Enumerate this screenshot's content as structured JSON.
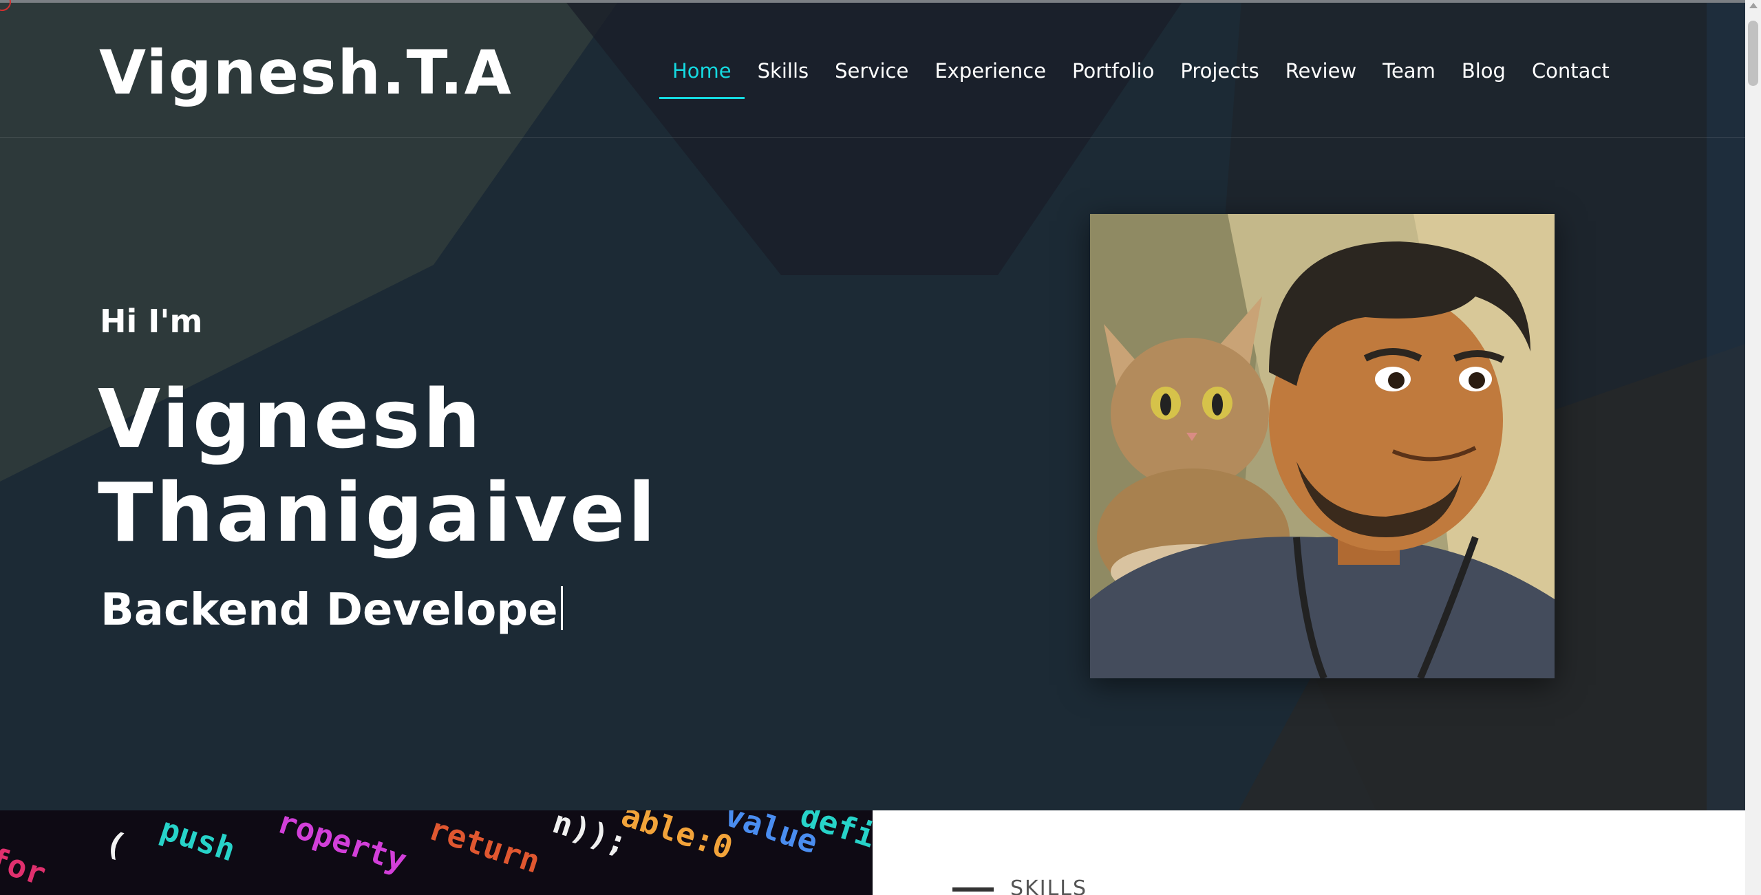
{
  "header": {
    "logo": "Vignesh.T.A",
    "nav": [
      {
        "label": "Home",
        "active": true
      },
      {
        "label": "Skills"
      },
      {
        "label": "Service"
      },
      {
        "label": "Experience"
      },
      {
        "label": "Portfolio"
      },
      {
        "label": "Projects"
      },
      {
        "label": "Review"
      },
      {
        "label": "Team"
      },
      {
        "label": "Blog"
      },
      {
        "label": "Contact"
      }
    ]
  },
  "hero": {
    "greeting": "Hi I'm",
    "name_first": "Vignesh",
    "name_last": "Thanigaivel",
    "role_typed": "Backend Develope"
  },
  "skills_section": {
    "label": "SKILLS"
  },
  "colors": {
    "accent": "#15d9e0",
    "hero_bg": "#1c2a35"
  },
  "icons": {
    "corner": "circle-icon",
    "scroll_up": "arrow-up-icon"
  }
}
